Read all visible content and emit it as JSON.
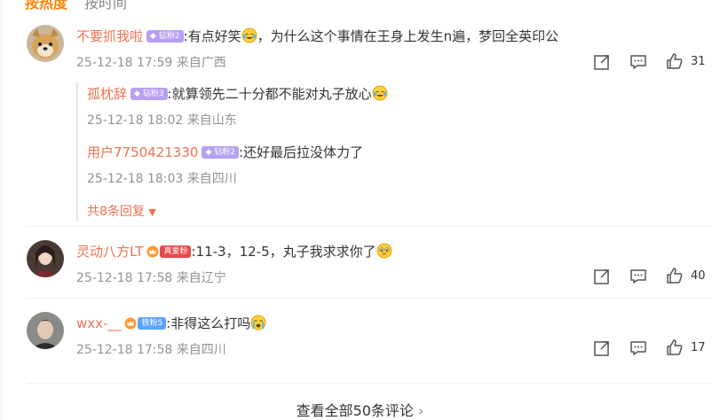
{
  "top_partial": {
    "left": "按热度",
    "right": "按时间"
  },
  "comments": [
    {
      "user": "不要抓我啦",
      "badge": "钻粉2",
      "text": ":有点好笑",
      "text_tail": "，为什么这个事情在王身上发生n遍，梦回全英印公",
      "meta": "25-12-18 17:59 来自广西",
      "likes": "31"
    },
    {
      "user": "灵动八方LT",
      "badge": "真爱粉",
      "text": ":11-3，12-5，丸子我求求你了",
      "meta": "25-12-18 17:58 来自辽宁",
      "likes": "40"
    },
    {
      "user": "wxx-__",
      "badge": "铁粉5",
      "text": ":非得这么打吗",
      "meta": "25-12-18 17:58 来自四川",
      "likes": "17"
    }
  ],
  "replies": [
    {
      "user": "孤枕辞",
      "badge": "钻粉3",
      "text": ":就算领先二十分都不能对丸子放心",
      "meta": "25-12-18 18:02 来自山东"
    },
    {
      "user": "用户7750421330",
      "badge": "钻粉2",
      "text": ":还好最后拉没体力了",
      "meta": "25-12-18 18:03 来自四川"
    }
  ],
  "more_replies": "共8条回复",
  "view_all": "查看全部50条评论",
  "colors": {
    "username": "#eb7350",
    "meta": "#939393",
    "badge_purple": "#b79ff2"
  },
  "icons": [
    "share-icon",
    "comment-icon",
    "like-icon",
    "laugh-cry-emoji",
    "crying-emoji",
    "pleading-emoji"
  ]
}
